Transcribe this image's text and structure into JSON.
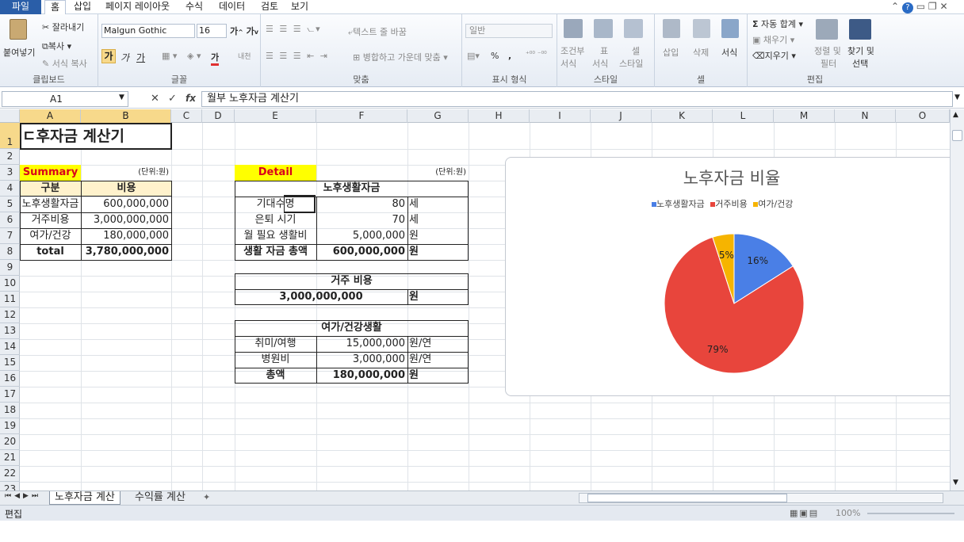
{
  "menu": {
    "file": "파일",
    "home": "홈",
    "insert": "삽입",
    "layout": "페이지 레이아웃",
    "formula": "수식",
    "data": "데이터",
    "review": "검토",
    "view": "보기"
  },
  "ribbon": {
    "paste": "붙여넣기",
    "cut": "잘라내기",
    "copy": "복사",
    "format_copy": "서식 복사",
    "clipboard": "클립보드",
    "font_name": "Malgun Gothic",
    "font_size": "16",
    "bold": "가",
    "italic": "가",
    "underline": "가",
    "grow": "가",
    "shrink": "가",
    "font_color": "가",
    "phonetic": "내천",
    "font_group": "글꼴",
    "wrap_text": "텍스트 줄 바꿈",
    "merge_center": "병합하고 가운데 맞춤",
    "align_group": "맞춤",
    "number_format": "일반",
    "percent": "%",
    "comma": ",",
    "number_group": "표시 형식",
    "cond_format": "조건부",
    "cond_format2": "서식",
    "table_format": "표",
    "table_format2": "서식",
    "cell_style": "셀",
    "cell_style2": "스타일",
    "style_group": "스타일",
    "insert": "삽입",
    "delete": "삭제",
    "format": "서식",
    "cells_group": "셀",
    "autosum": "자동 합계",
    "fill": "채우기",
    "clear": "지우기",
    "sort": "정렬 및",
    "sort2": "필터",
    "find": "찾기 및",
    "find2": "선택",
    "edit_group": "편집"
  },
  "formula_bar": {
    "name_box": "A1",
    "fx": "fx",
    "content": "월부 노후자금 계산기"
  },
  "columns": [
    "A",
    "B",
    "C",
    "D",
    "E",
    "F",
    "G",
    "H",
    "I",
    "J",
    "K",
    "L",
    "M",
    "N",
    "O"
  ],
  "rows": [
    "1",
    "2",
    "3",
    "4",
    "5",
    "6",
    "7",
    "8",
    "9",
    "10",
    "11",
    "12",
    "13",
    "14",
    "15",
    "16",
    "17",
    "18",
    "19",
    "20",
    "21",
    "22",
    "23"
  ],
  "sheet": {
    "title": "ㄷ후자금 계산기",
    "summary_label": "Summary",
    "summary_unit": "(단위:원)",
    "summary_head": [
      "구분",
      "비용"
    ],
    "summary_rows": [
      [
        "노후생활자금",
        "600,000,000"
      ],
      [
        "거주비용",
        "3,000,000,000"
      ],
      [
        "여가/건강",
        "180,000,000"
      ]
    ],
    "summary_total": [
      "total",
      "3,780,000,000"
    ],
    "detail_label": "Detail",
    "detail_unit": "(단위:원)",
    "living_head": "노후생활자금",
    "living_rows": [
      [
        "기대수명",
        "80",
        "세"
      ],
      [
        "은퇴 시기",
        "70",
        "세"
      ],
      [
        "월 필요 생활비",
        "5,000,000",
        "원"
      ]
    ],
    "living_total": [
      "생활 자금 총액",
      "600,000,000",
      "원"
    ],
    "housing_head": "거주 비용",
    "housing_value": "3,000,000,000",
    "housing_unit": "원",
    "leisure_head": "여가/건강생활",
    "leisure_rows": [
      [
        "취미/여행",
        "15,000,000",
        "원/연"
      ],
      [
        "병원비",
        "3,000,000",
        "원/연"
      ]
    ],
    "leisure_total": [
      "총액",
      "180,000,000",
      "원"
    ]
  },
  "chart_data": {
    "type": "pie",
    "title": "노후자금 비율",
    "categories": [
      "노후생활자금",
      "거주비용",
      "여가/건강"
    ],
    "values": [
      16,
      79,
      5
    ],
    "labels": [
      "16%",
      "79%",
      "5%"
    ],
    "colors": [
      "#4a7fe6",
      "#e8453c",
      "#f6b400"
    ],
    "legend": "top"
  },
  "tabs": [
    "노후자금 계산",
    "수익률 계산"
  ],
  "status": {
    "mode": "편집",
    "zoom": "100%"
  }
}
